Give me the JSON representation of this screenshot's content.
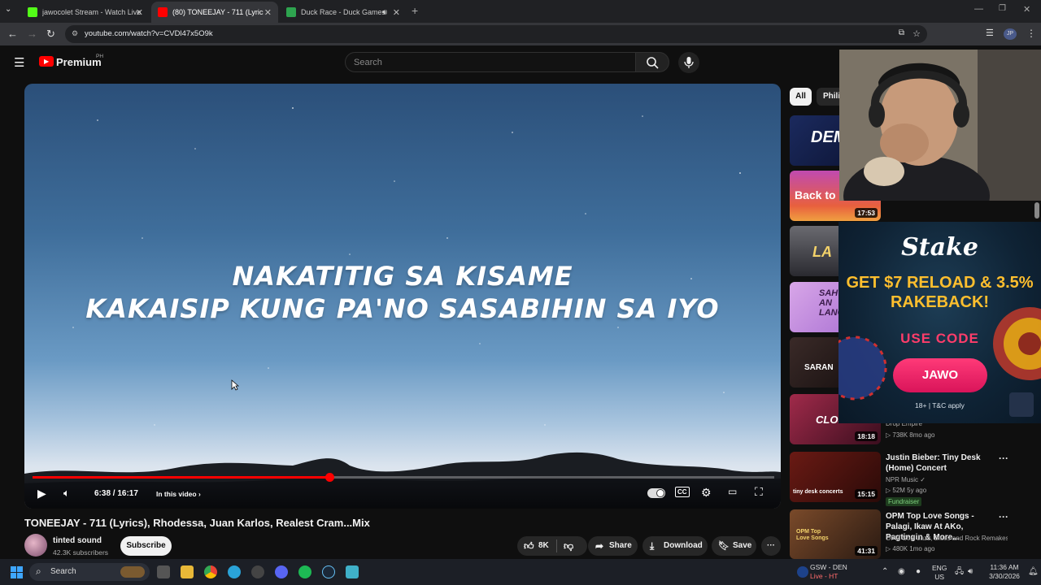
{
  "browser": {
    "tabs": [
      {
        "title": "jawocolet Stream - Watch Live on Kick",
        "active": false,
        "favicon_color": "#53fc18"
      },
      {
        "title": "(80) TONEEJAY - 711 (Lyrics), Rhodessa...",
        "active": true,
        "favicon_color": "#ff0000"
      },
      {
        "title": "Duck Race - Duck Games",
        "active": false,
        "favicon_color": "#2ea44f"
      }
    ],
    "url": "youtube.com/watch?v=CVDl47x5O9k",
    "profile_initials": "JP"
  },
  "youtube": {
    "logo_label": "Premium",
    "logo_region": "PH",
    "search_placeholder": "Search"
  },
  "player": {
    "lyrics_line1": "NAKATITIG SA KISAME",
    "lyrics_line2": "KAKAISIP KUNG PA'NO SASABIHIN SA IYO",
    "time": "6:38 / 16:17",
    "chapter": "In this video",
    "progress_fraction": 0.4
  },
  "video": {
    "title": "TONEEJAY - 711 (Lyrics), Rhodessa, Juan Karlos, Realest Cram...Mix",
    "channel": "tinted sound",
    "subscribers": "42.3K subscribers",
    "subscribe_label": "Subscribe",
    "likes": "8K",
    "share_label": "Share",
    "download_label": "Download",
    "save_label": "Save"
  },
  "sidebar": {
    "chips": [
      "All",
      "Philip"
    ],
    "items": [
      {
        "thumb_text": "DEM",
        "duration": ""
      },
      {
        "thumb_text": "Back to",
        "duration": "17:53"
      },
      {
        "thumb_text": "LA",
        "duration": ""
      },
      {
        "thumb_text": "SAH AN LANG",
        "duration": ""
      },
      {
        "thumb_text": "SARAN",
        "duration": ""
      },
      {
        "thumb_text": "CLOS",
        "duration": "18:18",
        "channel": "Drop Empire",
        "meta": "▷ 738K  8mo ago"
      },
      {
        "thumb_text": "tiny desk concerts",
        "duration": "15:15",
        "title": "Justin Bieber: Tiny Desk (Home) Concert",
        "channel": "NPR Music ✓",
        "meta": "▷ 52M  5y ago",
        "badge": "Fundraiser"
      },
      {
        "thumb_text": "OPM Top Love Songs",
        "duration": "41:31",
        "title": "OPM Top Love Songs - Palagi, Ikaw At AKo, Pagtingin & More...",
        "channel": "OPM Soul Jazz, Blues and Rock Remakes",
        "meta": "▷ 480K  1mo ago"
      }
    ]
  },
  "ad": {
    "brand": "Stake",
    "headline": "GET $7 RELOAD & 3.5% RAKEBACK!",
    "use_code": "USE CODE",
    "code": "JAWO",
    "legal": "18+ | T&C apply"
  },
  "taskbar": {
    "search_label": "Search",
    "score_line1": "GSW - DEN",
    "score_line2": "Live - HT",
    "lang_line1": "ENG",
    "lang_line2": "US",
    "time": "11:36 AM",
    "date": "3/30/2026"
  }
}
